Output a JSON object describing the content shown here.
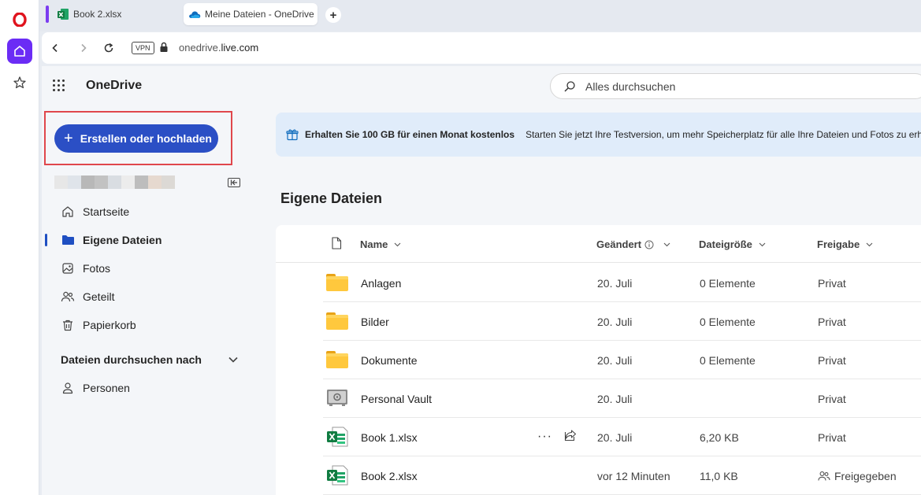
{
  "browser": {
    "tabs": [
      {
        "title": "Book 2.xlsx",
        "icon": "excel-icon"
      },
      {
        "title": "Meine Dateien - OneDrive",
        "icon": "onedrive-cloud-icon",
        "active": true
      }
    ],
    "new_tab": "+",
    "vpn_label": "VPN",
    "url_prefix": "onedrive.",
    "url_domain": "live.com"
  },
  "app": {
    "title": "OneDrive",
    "search_placeholder": "Alles durchsuchen"
  },
  "sidebar": {
    "create_label": "Erstellen oder hochladen",
    "create_plus": "+",
    "items": [
      {
        "label": "Startseite",
        "icon": "home-icon"
      },
      {
        "label": "Eigene Dateien",
        "icon": "folder-icon",
        "active": true
      },
      {
        "label": "Fotos",
        "icon": "photo-icon"
      },
      {
        "label": "Geteilt",
        "icon": "people-icon"
      },
      {
        "label": "Papierkorb",
        "icon": "trash-icon"
      }
    ],
    "browse_header": "Dateien durchsuchen nach",
    "browse_items": [
      {
        "label": "Personen",
        "icon": "person-icon"
      }
    ]
  },
  "promo": {
    "title": "Erhalten Sie 100 GB für einen Monat kostenlos",
    "text": "Starten Sie jetzt Ihre Testversion, um mehr Speicherplatz für alle Ihre Dateien und Fotos zu erhalten."
  },
  "main": {
    "section_title": "Eigene Dateien",
    "columns": {
      "name": "Name",
      "modified": "Geändert",
      "size": "Dateigröße",
      "sharing": "Freigabe"
    },
    "files": [
      {
        "name": "Anlagen",
        "type": "folder",
        "modified": "20. Juli",
        "size": "0 Elemente",
        "sharing": "Privat"
      },
      {
        "name": "Bilder",
        "type": "folder",
        "modified": "20. Juli",
        "size": "0 Elemente",
        "sharing": "Privat"
      },
      {
        "name": "Dokumente",
        "type": "folder",
        "modified": "20. Juli",
        "size": "0 Elemente",
        "sharing": "Privat"
      },
      {
        "name": "Personal Vault",
        "type": "vault",
        "modified": "20. Juli",
        "size": "",
        "sharing": "Privat"
      },
      {
        "name": "Book 1.xlsx",
        "type": "excel",
        "modified": "20. Juli",
        "size": "6,20 KB",
        "sharing": "Privat",
        "more": "···"
      },
      {
        "name": "Book 2.xlsx",
        "type": "excel",
        "modified": "vor 12 Minuten",
        "size": "11,0 KB",
        "sharing": "Freigegeben"
      }
    ]
  },
  "colors": {
    "accent": "#2b4fc5",
    "highlight": "#e0474c",
    "promo_bg": "#e0ecfa",
    "opera_purple": "#6b2cf5"
  }
}
